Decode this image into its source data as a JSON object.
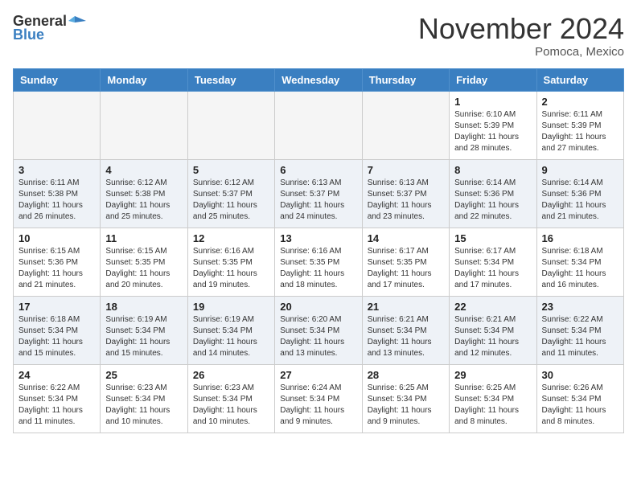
{
  "header": {
    "logo_general": "General",
    "logo_blue": "Blue",
    "month_title": "November 2024",
    "location": "Pomoca, Mexico"
  },
  "weekdays": [
    "Sunday",
    "Monday",
    "Tuesday",
    "Wednesday",
    "Thursday",
    "Friday",
    "Saturday"
  ],
  "weeks": [
    [
      {
        "day": "",
        "info": ""
      },
      {
        "day": "",
        "info": ""
      },
      {
        "day": "",
        "info": ""
      },
      {
        "day": "",
        "info": ""
      },
      {
        "day": "",
        "info": ""
      },
      {
        "day": "1",
        "info": "Sunrise: 6:10 AM\nSunset: 5:39 PM\nDaylight: 11 hours\nand 28 minutes."
      },
      {
        "day": "2",
        "info": "Sunrise: 6:11 AM\nSunset: 5:39 PM\nDaylight: 11 hours\nand 27 minutes."
      }
    ],
    [
      {
        "day": "3",
        "info": "Sunrise: 6:11 AM\nSunset: 5:38 PM\nDaylight: 11 hours\nand 26 minutes."
      },
      {
        "day": "4",
        "info": "Sunrise: 6:12 AM\nSunset: 5:38 PM\nDaylight: 11 hours\nand 25 minutes."
      },
      {
        "day": "5",
        "info": "Sunrise: 6:12 AM\nSunset: 5:37 PM\nDaylight: 11 hours\nand 25 minutes."
      },
      {
        "day": "6",
        "info": "Sunrise: 6:13 AM\nSunset: 5:37 PM\nDaylight: 11 hours\nand 24 minutes."
      },
      {
        "day": "7",
        "info": "Sunrise: 6:13 AM\nSunset: 5:37 PM\nDaylight: 11 hours\nand 23 minutes."
      },
      {
        "day": "8",
        "info": "Sunrise: 6:14 AM\nSunset: 5:36 PM\nDaylight: 11 hours\nand 22 minutes."
      },
      {
        "day": "9",
        "info": "Sunrise: 6:14 AM\nSunset: 5:36 PM\nDaylight: 11 hours\nand 21 minutes."
      }
    ],
    [
      {
        "day": "10",
        "info": "Sunrise: 6:15 AM\nSunset: 5:36 PM\nDaylight: 11 hours\nand 21 minutes."
      },
      {
        "day": "11",
        "info": "Sunrise: 6:15 AM\nSunset: 5:35 PM\nDaylight: 11 hours\nand 20 minutes."
      },
      {
        "day": "12",
        "info": "Sunrise: 6:16 AM\nSunset: 5:35 PM\nDaylight: 11 hours\nand 19 minutes."
      },
      {
        "day": "13",
        "info": "Sunrise: 6:16 AM\nSunset: 5:35 PM\nDaylight: 11 hours\nand 18 minutes."
      },
      {
        "day": "14",
        "info": "Sunrise: 6:17 AM\nSunset: 5:35 PM\nDaylight: 11 hours\nand 17 minutes."
      },
      {
        "day": "15",
        "info": "Sunrise: 6:17 AM\nSunset: 5:34 PM\nDaylight: 11 hours\nand 17 minutes."
      },
      {
        "day": "16",
        "info": "Sunrise: 6:18 AM\nSunset: 5:34 PM\nDaylight: 11 hours\nand 16 minutes."
      }
    ],
    [
      {
        "day": "17",
        "info": "Sunrise: 6:18 AM\nSunset: 5:34 PM\nDaylight: 11 hours\nand 15 minutes."
      },
      {
        "day": "18",
        "info": "Sunrise: 6:19 AM\nSunset: 5:34 PM\nDaylight: 11 hours\nand 15 minutes."
      },
      {
        "day": "19",
        "info": "Sunrise: 6:19 AM\nSunset: 5:34 PM\nDaylight: 11 hours\nand 14 minutes."
      },
      {
        "day": "20",
        "info": "Sunrise: 6:20 AM\nSunset: 5:34 PM\nDaylight: 11 hours\nand 13 minutes."
      },
      {
        "day": "21",
        "info": "Sunrise: 6:21 AM\nSunset: 5:34 PM\nDaylight: 11 hours\nand 13 minutes."
      },
      {
        "day": "22",
        "info": "Sunrise: 6:21 AM\nSunset: 5:34 PM\nDaylight: 11 hours\nand 12 minutes."
      },
      {
        "day": "23",
        "info": "Sunrise: 6:22 AM\nSunset: 5:34 PM\nDaylight: 11 hours\nand 11 minutes."
      }
    ],
    [
      {
        "day": "24",
        "info": "Sunrise: 6:22 AM\nSunset: 5:34 PM\nDaylight: 11 hours\nand 11 minutes."
      },
      {
        "day": "25",
        "info": "Sunrise: 6:23 AM\nSunset: 5:34 PM\nDaylight: 11 hours\nand 10 minutes."
      },
      {
        "day": "26",
        "info": "Sunrise: 6:23 AM\nSunset: 5:34 PM\nDaylight: 11 hours\nand 10 minutes."
      },
      {
        "day": "27",
        "info": "Sunrise: 6:24 AM\nSunset: 5:34 PM\nDaylight: 11 hours\nand 9 minutes."
      },
      {
        "day": "28",
        "info": "Sunrise: 6:25 AM\nSunset: 5:34 PM\nDaylight: 11 hours\nand 9 minutes."
      },
      {
        "day": "29",
        "info": "Sunrise: 6:25 AM\nSunset: 5:34 PM\nDaylight: 11 hours\nand 8 minutes."
      },
      {
        "day": "30",
        "info": "Sunrise: 6:26 AM\nSunset: 5:34 PM\nDaylight: 11 hours\nand 8 minutes."
      }
    ]
  ]
}
